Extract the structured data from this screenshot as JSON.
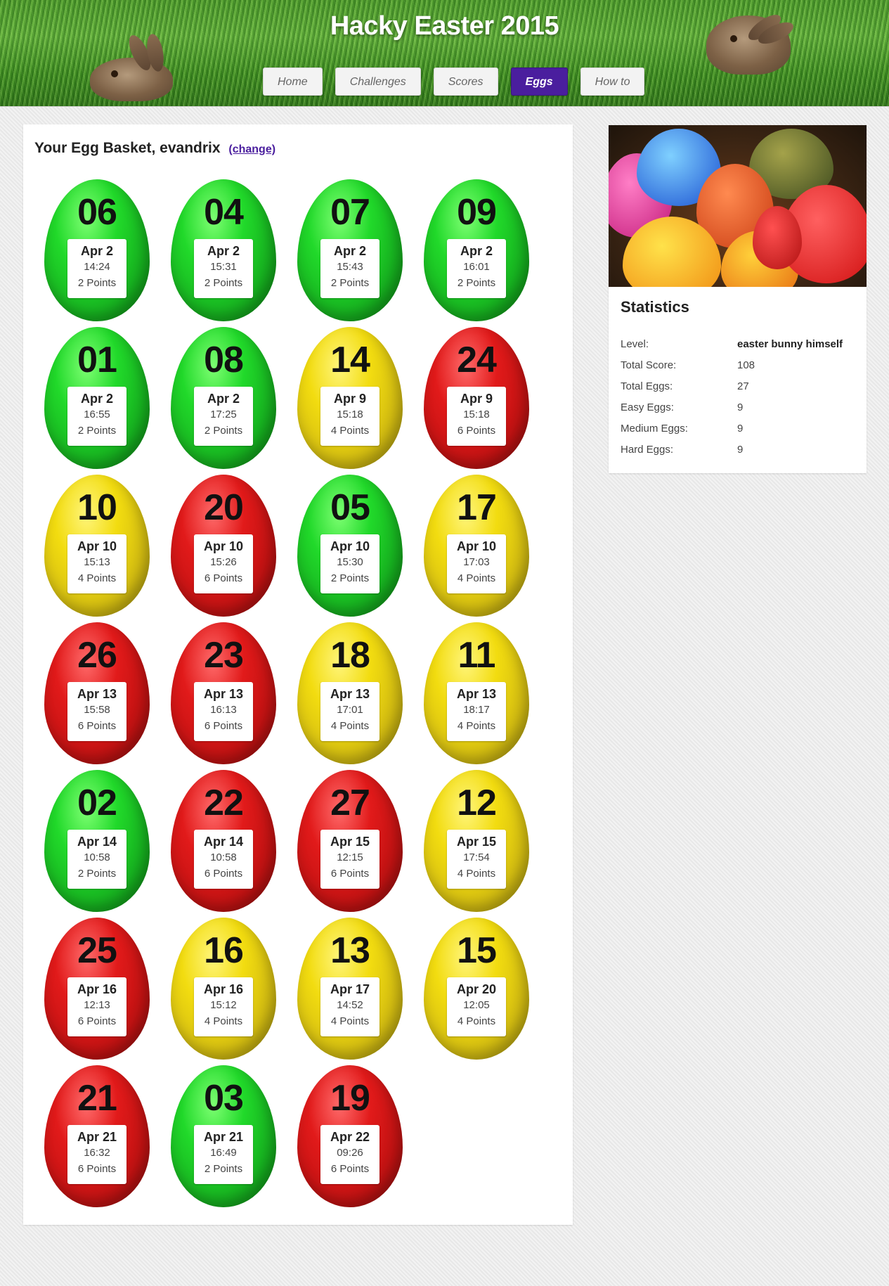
{
  "header": {
    "title": "Hacky Easter 2015",
    "nav": [
      {
        "label": "Home",
        "active": false
      },
      {
        "label": "Challenges",
        "active": false
      },
      {
        "label": "Scores",
        "active": false
      },
      {
        "label": "Eggs",
        "active": true
      },
      {
        "label": "How to",
        "active": false
      }
    ]
  },
  "basket": {
    "heading": "Your Egg Basket, evandrix",
    "change_label": "(change)",
    "eggs": [
      {
        "number": "06",
        "date": "Apr 2",
        "time": "14:24",
        "points": "2 Points",
        "color": "green"
      },
      {
        "number": "04",
        "date": "Apr 2",
        "time": "15:31",
        "points": "2 Points",
        "color": "green"
      },
      {
        "number": "07",
        "date": "Apr 2",
        "time": "15:43",
        "points": "2 Points",
        "color": "green"
      },
      {
        "number": "09",
        "date": "Apr 2",
        "time": "16:01",
        "points": "2 Points",
        "color": "green"
      },
      {
        "number": "01",
        "date": "Apr 2",
        "time": "16:55",
        "points": "2 Points",
        "color": "green"
      },
      {
        "number": "08",
        "date": "Apr 2",
        "time": "17:25",
        "points": "2 Points",
        "color": "green"
      },
      {
        "number": "14",
        "date": "Apr 9",
        "time": "15:18",
        "points": "4 Points",
        "color": "yellow"
      },
      {
        "number": "24",
        "date": "Apr 9",
        "time": "15:18",
        "points": "6 Points",
        "color": "red"
      },
      {
        "number": "10",
        "date": "Apr 10",
        "time": "15:13",
        "points": "4 Points",
        "color": "yellow"
      },
      {
        "number": "20",
        "date": "Apr 10",
        "time": "15:26",
        "points": "6 Points",
        "color": "red"
      },
      {
        "number": "05",
        "date": "Apr 10",
        "time": "15:30",
        "points": "2 Points",
        "color": "green"
      },
      {
        "number": "17",
        "date": "Apr 10",
        "time": "17:03",
        "points": "4 Points",
        "color": "yellow"
      },
      {
        "number": "26",
        "date": "Apr 13",
        "time": "15:58",
        "points": "6 Points",
        "color": "red"
      },
      {
        "number": "23",
        "date": "Apr 13",
        "time": "16:13",
        "points": "6 Points",
        "color": "red"
      },
      {
        "number": "18",
        "date": "Apr 13",
        "time": "17:01",
        "points": "4 Points",
        "color": "yellow"
      },
      {
        "number": "11",
        "date": "Apr 13",
        "time": "18:17",
        "points": "4 Points",
        "color": "yellow"
      },
      {
        "number": "02",
        "date": "Apr 14",
        "time": "10:58",
        "points": "2 Points",
        "color": "green"
      },
      {
        "number": "22",
        "date": "Apr 14",
        "time": "10:58",
        "points": "6 Points",
        "color": "red"
      },
      {
        "number": "27",
        "date": "Apr 15",
        "time": "12:15",
        "points": "6 Points",
        "color": "red"
      },
      {
        "number": "12",
        "date": "Apr 15",
        "time": "17:54",
        "points": "4 Points",
        "color": "yellow"
      },
      {
        "number": "25",
        "date": "Apr 16",
        "time": "12:13",
        "points": "6 Points",
        "color": "red"
      },
      {
        "number": "16",
        "date": "Apr 16",
        "time": "15:12",
        "points": "4 Points",
        "color": "yellow"
      },
      {
        "number": "13",
        "date": "Apr 17",
        "time": "14:52",
        "points": "4 Points",
        "color": "yellow"
      },
      {
        "number": "15",
        "date": "Apr 20",
        "time": "12:05",
        "points": "4 Points",
        "color": "yellow"
      },
      {
        "number": "21",
        "date": "Apr 21",
        "time": "16:32",
        "points": "6 Points",
        "color": "red"
      },
      {
        "number": "03",
        "date": "Apr 21",
        "time": "16:49",
        "points": "2 Points",
        "color": "green"
      },
      {
        "number": "19",
        "date": "Apr 22",
        "time": "09:26",
        "points": "6 Points",
        "color": "red"
      }
    ]
  },
  "sidebar": {
    "stats_title": "Statistics",
    "stats": [
      {
        "label": "Level:",
        "value": "easter bunny himself",
        "strong": true
      },
      {
        "label": "Total Score:",
        "value": "108"
      },
      {
        "label": "Total Eggs:",
        "value": "27"
      },
      {
        "label": "Easy Eggs:",
        "value": "9"
      },
      {
        "label": "Medium Eggs:",
        "value": "9"
      },
      {
        "label": "Hard Eggs:",
        "value": "9"
      }
    ]
  },
  "colors": {
    "accent": "#4a1e9e",
    "egg_green": "#21d92a",
    "egg_yellow": "#f2dc10",
    "egg_red": "#e11a1a"
  }
}
